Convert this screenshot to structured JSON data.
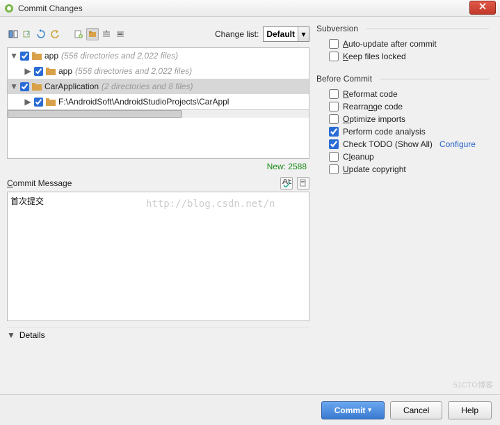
{
  "window": {
    "title": "Commit Changes"
  },
  "toolbar": {
    "change_list_label": "Change list:",
    "change_list_value": "Default"
  },
  "tree": {
    "rows": [
      {
        "indent": 0,
        "arrow": "▼",
        "checked": true,
        "folder_color": "#d9a24a",
        "label": "app",
        "info": "(556 directories and 2,022 files)"
      },
      {
        "indent": 1,
        "arrow": "▶",
        "checked": true,
        "folder_color": "#d9a24a",
        "label": "app",
        "info": "(556 directories and 2,022 files)"
      },
      {
        "indent": 0,
        "arrow": "▼",
        "checked": true,
        "folder_color": "#d9a24a",
        "label": "CarApplication",
        "info": "(2 directories and 8 files)",
        "selected": true
      },
      {
        "indent": 1,
        "arrow": "▶",
        "checked": true,
        "folder_color": "#d9a24a",
        "label": "",
        "path": "F:\\AndroidSoft\\AndroidStudioProjects\\CarAppl"
      }
    ],
    "new_count": "New: 2588"
  },
  "commit_message": {
    "label_html": "Commit Message",
    "value": "首次提交"
  },
  "details": {
    "label": "Details"
  },
  "subversion": {
    "title": "Subversion",
    "auto_update": {
      "label": "Auto-update after commit",
      "checked": false
    },
    "keep_locked": {
      "label": "Keep files locked",
      "checked": false
    }
  },
  "before_commit": {
    "title": "Before Commit",
    "reformat": {
      "label": "Reformat code",
      "checked": false
    },
    "rearrange": {
      "label": "Rearrange code",
      "checked": false
    },
    "optimize": {
      "label": "Optimize imports",
      "checked": false
    },
    "analysis": {
      "label": "Perform code analysis",
      "checked": true
    },
    "todo": {
      "label": "Check TODO (Show All)",
      "checked": true,
      "configure": "Configure"
    },
    "cleanup": {
      "label": "Cleanup",
      "checked": false
    },
    "copyright": {
      "label": "Update copyright",
      "checked": false
    }
  },
  "footer": {
    "commit": "Commit",
    "cancel": "Cancel",
    "help": "Help"
  },
  "watermark": "http://blog.csdn.net/n",
  "watermark2": "51CTO博客"
}
